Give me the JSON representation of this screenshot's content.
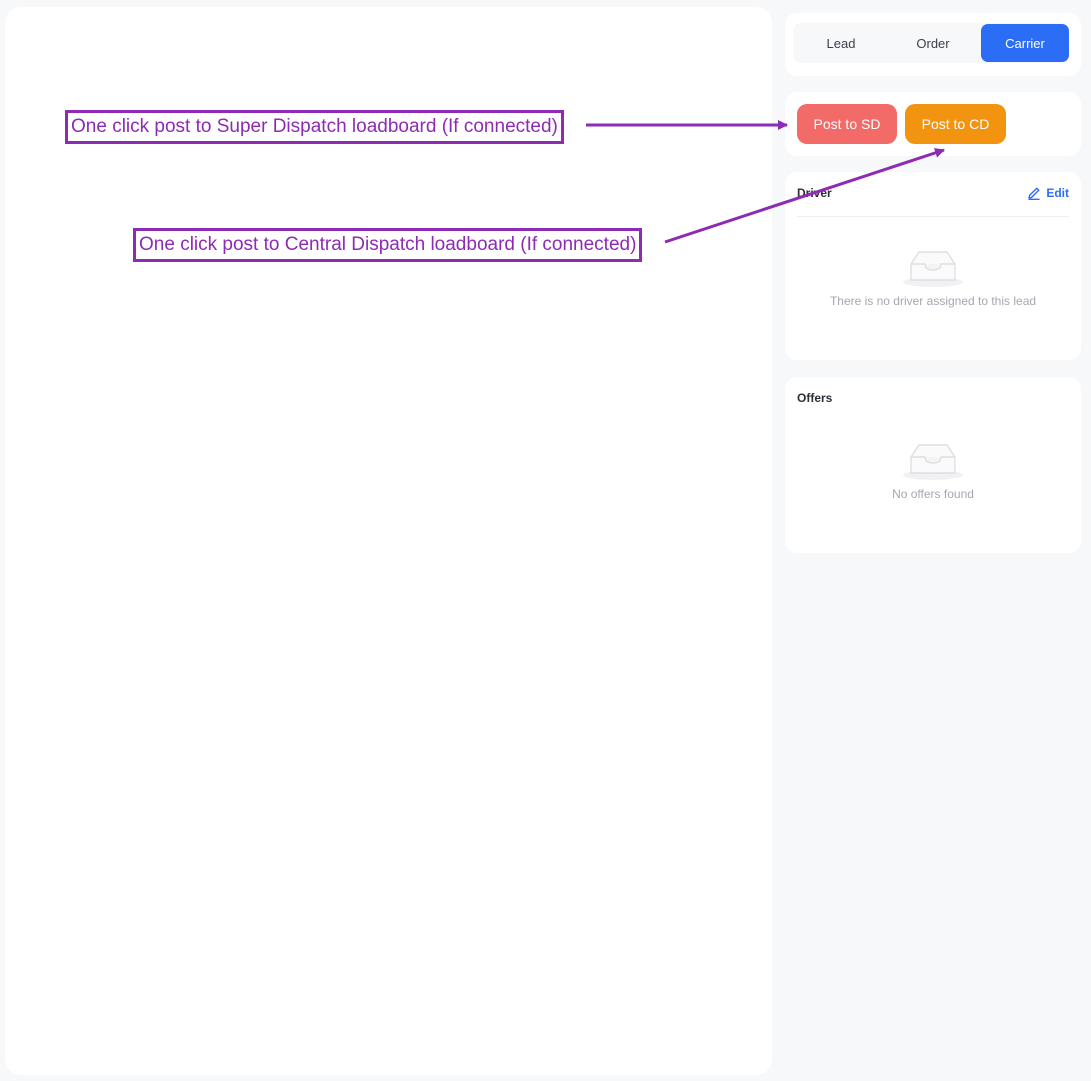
{
  "tabs": [
    {
      "label": "Lead"
    },
    {
      "label": "Order"
    },
    {
      "label": "Carrier",
      "active": true
    }
  ],
  "post_buttons": {
    "sd_label": "Post to SD",
    "cd_label": "Post to CD"
  },
  "driver": {
    "title": "Driver",
    "edit_label": "Edit",
    "empty_text": "There is no driver assigned to this lead"
  },
  "offers": {
    "title": "Offers",
    "empty_text": "No offers found"
  },
  "annotations": {
    "sd": "One click post to Super Dispatch loadboard (If connected)",
    "cd": "One click post to Central Dispatch loadboard (If connected)"
  },
  "colors": {
    "accent": "#2b6ef5",
    "sd_button": "#f26b69",
    "cd_button": "#f39411",
    "annotation": "#8e2bb3"
  },
  "icons": [
    "pencil-icon",
    "empty-inbox-icon"
  ]
}
